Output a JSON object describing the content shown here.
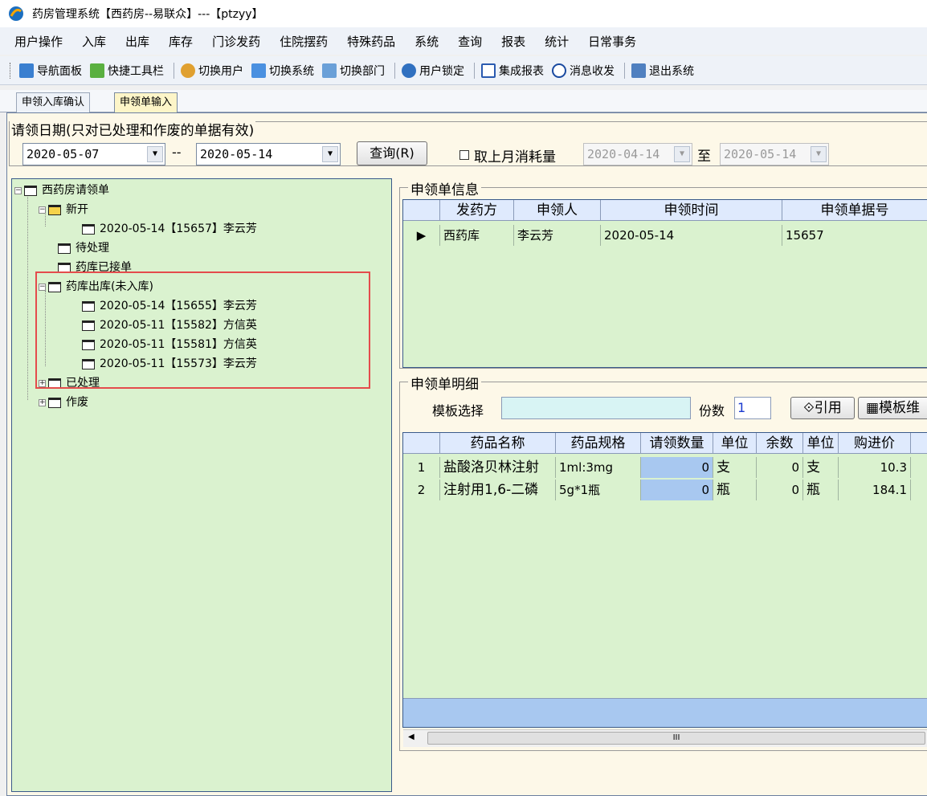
{
  "title": "药房管理系统【西药房--易联众】---【ptzyy】",
  "menu": [
    "用户操作",
    "入库",
    "出库",
    "库存",
    "门诊发药",
    "住院摆药",
    "特殊药品",
    "系统",
    "查询",
    "报表",
    "统计",
    "日常事务"
  ],
  "toolbar": [
    "导航面板",
    "快捷工具栏",
    "切换用户",
    "切换系统",
    "切换部门",
    "用户锁定",
    "集成报表",
    "消息收发",
    "退出系统"
  ],
  "tabs": [
    "申领入库确认",
    "申领单输入"
  ],
  "filter": {
    "legend": "请领日期(只对已处理和作废的单据有效)",
    "date_from": "2020-05-07",
    "sep": "--",
    "date_to": "2020-05-14",
    "query_btn": "查询(R)",
    "checkbox": "取上月消耗量",
    "last_from": "2020-04-14",
    "to_label": "至",
    "last_to": "2020-05-14"
  },
  "tree": {
    "root": "西药房请领单",
    "new": "新开",
    "new_item": "2020-05-14【15657】李云芳",
    "pending": "待处理",
    "accepted": "药库已接单",
    "shipped": "药库出库(未入库)",
    "shipped_items": [
      "2020-05-14【15655】李云芳",
      "2020-05-11【15582】方信英",
      "2020-05-11【15581】方信英",
      "2020-05-11【15573】李云芳"
    ],
    "processed": "已处理",
    "voided": "作废"
  },
  "info": {
    "title": "申领单信息",
    "headers": [
      "发药方",
      "申领人",
      "申领时间",
      "申领单据号"
    ],
    "row": [
      "西药库",
      "李云芳",
      "2020-05-14",
      "15657"
    ]
  },
  "detail": {
    "title": "申领单明细",
    "template_label": "模板选择",
    "copies_label": "份数",
    "copies": "1",
    "ref_btn": "引用",
    "tpl_btn": "模板维",
    "headers": [
      "药品名称",
      "药品规格",
      "请领数量",
      "单位",
      "余数",
      "单位",
      "购进价"
    ],
    "rows": [
      [
        "1",
        "盐酸洛贝林注射",
        "1ml:3mg",
        "0",
        "支",
        "0",
        "支",
        "10.3"
      ],
      [
        "2",
        "注射用1,6-二磷",
        "5g*1瓶",
        "0",
        "瓶",
        "0",
        "瓶",
        "184.1"
      ]
    ]
  },
  "scroll_label": "III"
}
